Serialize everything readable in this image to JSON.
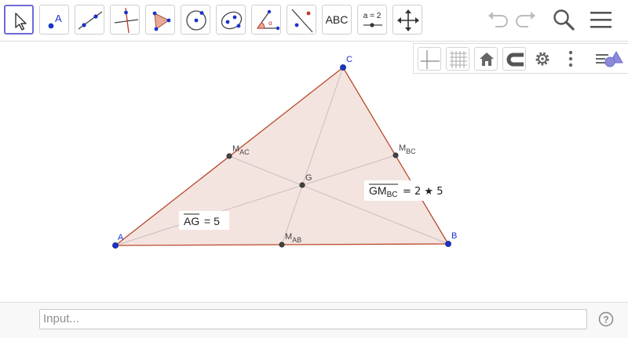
{
  "toolbar": {
    "text_tool_label": "ABC",
    "slider_tool_label": "a = 2"
  },
  "points": {
    "A": "A",
    "B": "B",
    "C": "C",
    "G": "G",
    "m_ac_base": "M",
    "m_ac_sub": "AC",
    "m_bc_base": "M",
    "m_bc_sub": "BC",
    "m_ab_base": "M",
    "m_ab_sub": "AB"
  },
  "measurements": {
    "ag_label": "AG",
    "ag_value": "= 5",
    "gm_label_base": "GM",
    "gm_label_sub": "BC",
    "gm_value": "= 2 ★ 5"
  },
  "input_bar": {
    "placeholder": "Input..."
  },
  "colors": {
    "accent": "#6d6bd6",
    "point_blue": "#1a33cc",
    "triangle_edge": "#c0392b",
    "triangle_fill": "#f5e6e1"
  }
}
